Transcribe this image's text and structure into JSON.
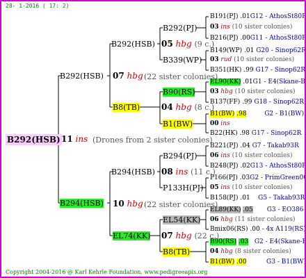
{
  "date": "28- 1-2016 ( 17: 2)",
  "copyright": "Copyright 2004-2016 @ Karl Kehrle Foundation.   www.pedigreeapis.org",
  "root": {
    "label": "B292(HSB)",
    "num": "11",
    "tag": "ins",
    "note": "(Drones from 2 sister colonies)"
  },
  "g1": [
    {
      "label": "B292(HSB)",
      "num": "07",
      "tag": "hbg",
      "note": "(22 sister colonies)"
    },
    {
      "label": "B294(HSB)",
      "num": "10",
      "tag": "hbg",
      "note": "(22 sister colonies)"
    }
  ],
  "g2": [
    {
      "label": "B292(HSB)",
      "num": "05",
      "tag": "hbg",
      "note": "(9 c.)"
    },
    {
      "label": "B8(TB)",
      "num": "04",
      "tag": "hbg",
      "note": "(8 c.)"
    },
    {
      "label": "B294(HSB)",
      "num": "08",
      "tag": "ins",
      "note": "(11 c.)"
    },
    {
      "label": "EL74(KK)",
      "num": "07",
      "tag": "hbg",
      "note": "(22 c.)"
    }
  ],
  "g3": [
    {
      "label": "B292(PJ)"
    },
    {
      "label": "B339(WP)"
    },
    {
      "label": "B90(RS)"
    },
    {
      "label": "B1(BW)"
    },
    {
      "label": "B294(PJ)"
    },
    {
      "label": "P133H(PJ)"
    },
    {
      "label": "EL54(KK)"
    },
    {
      "label": "B8(TB)"
    }
  ],
  "g4": [
    {
      "label": "B191(PJ)",
      "val": ".01",
      "code": "G12 - AthosSt80R"
    },
    {
      "num": "03",
      "tag": "ins",
      "note": "(10 sister colonies)"
    },
    {
      "label": "B216(PJ)",
      "val": ".00",
      "code": "G11 - AthosSt80R"
    },
    {
      "label": "B149(WP)",
      "val": ".01",
      "code": "G20 - Sinop62R"
    },
    {
      "num": "03",
      "tag": "rud",
      "note": "(10 sister colonies)"
    },
    {
      "label": "B351(HK)",
      "val": ".99",
      "code": "G17 - Sinop62R"
    },
    {
      "label": "EL90(KK)",
      "val": ".01",
      "code": "G1 - E4(Skane-B)"
    },
    {
      "num": "03",
      "tag": "hbg",
      "note": "(10 sister colonies)"
    },
    {
      "label": "B137(FF)",
      "val": ".99",
      "code": "G18 - Sinop62R"
    },
    {
      "label": "B1(BW)",
      "val": ".98",
      "code": "G2 - B1(BW)"
    },
    {
      "num": "00",
      "tag": "ins",
      "note": ""
    },
    {
      "label": "B22(HK)",
      "val": ".98",
      "code": "G17 - Sinop62R"
    },
    {
      "label": "B221(PJ)",
      "val": ".04",
      "code": "G7 - Takab93R"
    },
    {
      "num": "06",
      "tag": "ins",
      "note": "(10 sister colonies)"
    },
    {
      "label": "B248(PJ)",
      "val": ".02",
      "code": "G13 - AthosSt80R"
    },
    {
      "label": "P166(PJ)",
      "val": ".03",
      "code": "G2 - PrimGreen00"
    },
    {
      "num": "05",
      "tag": "ins",
      "note": "(10 sister colonies)"
    },
    {
      "label": "B158(PJ)",
      "val": ".01",
      "code": "G5 - Takab93R"
    },
    {
      "label": "EL89(KK)",
      "val": ".05",
      "code": "G3 - EO386"
    },
    {
      "num": "06",
      "tag": "hbg",
      "note": "(11 sister colonies)"
    },
    {
      "label": "Bmix06(RS)",
      "val": ".00",
      "code": "- 4x A119(RS)"
    },
    {
      "label": "B90(RS)",
      "val": ".03",
      "code": "G2 - E4(Skane-B)"
    },
    {
      "num": "04",
      "tag": "hbg",
      "note": "(8 sister colonies)"
    },
    {
      "label": "B1(BW)",
      "val": ".00",
      "code": "G3 - B1(BW)"
    }
  ]
}
